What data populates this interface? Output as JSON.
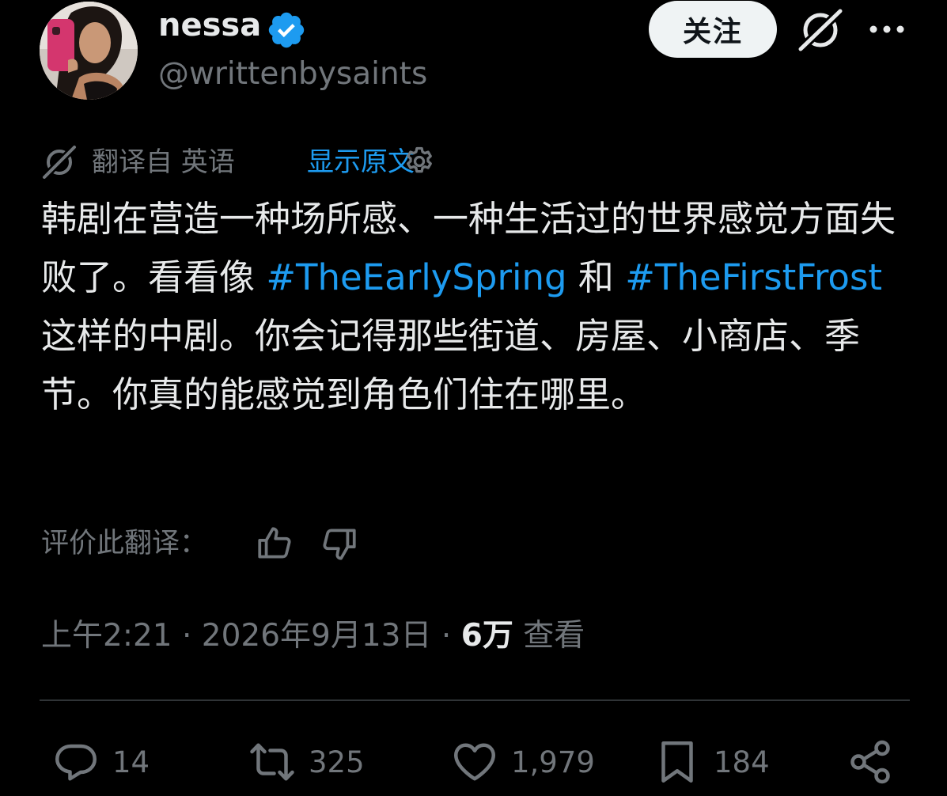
{
  "author": {
    "display_name": "nessa",
    "handle": "@writtenbysaints",
    "verified": true
  },
  "header": {
    "follow_label": "关注"
  },
  "translation": {
    "from_label": "翻译自 英语",
    "show_original_label": "显示原文"
  },
  "tweet": {
    "segments": [
      {
        "text": "韩剧在营造一种场所感、一种生活过的世界感觉方面失败了。看看像 ",
        "hashtag": false
      },
      {
        "text": "#TheEarlySpring",
        "hashtag": true
      },
      {
        "text": " 和 ",
        "hashtag": false
      },
      {
        "text": "#TheFirstFrost",
        "hashtag": true
      },
      {
        "text": " 这样的中剧。你会记得那些街道、房屋、小商店、季节。你真的能感觉到角色们住在哪里。",
        "hashtag": false
      }
    ]
  },
  "rate": {
    "label": "评价此翻译："
  },
  "meta": {
    "time": "上午2:21",
    "date": "2026年9月13日",
    "views_count": "6万",
    "views_label": "查看"
  },
  "actions": {
    "replies": "14",
    "retweets": "325",
    "likes": "1,979",
    "bookmarks": "184"
  },
  "colors": {
    "accent": "#1d9bf0",
    "muted": "#71767b",
    "text": "#e7e9ea",
    "background": "#000000"
  },
  "icons": [
    "verified-badge-icon",
    "grok-icon",
    "more-icon",
    "translate-icon",
    "settings-gear-icon",
    "thumbs-up-icon",
    "thumbs-down-icon",
    "reply-icon",
    "retweet-icon",
    "like-heart-icon",
    "bookmark-icon",
    "share-icon"
  ]
}
